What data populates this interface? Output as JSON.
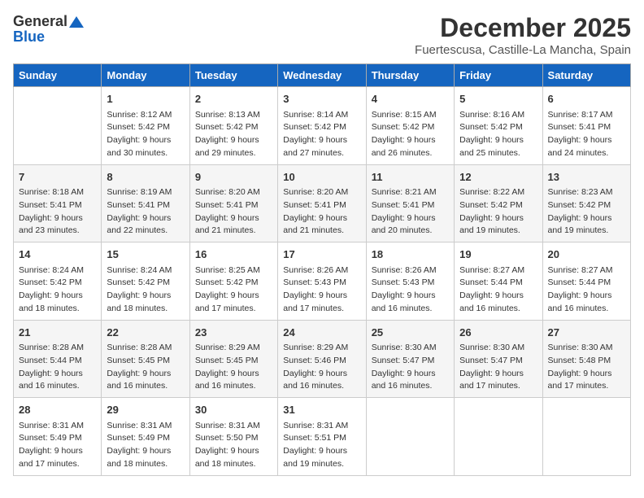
{
  "logo": {
    "general": "General",
    "blue": "Blue"
  },
  "title": "December 2025",
  "subtitle": "Fuertescusa, Castille-La Mancha, Spain",
  "days_of_week": [
    "Sunday",
    "Monday",
    "Tuesday",
    "Wednesday",
    "Thursday",
    "Friday",
    "Saturday"
  ],
  "weeks": [
    [
      {
        "day": "",
        "info": ""
      },
      {
        "day": "1",
        "info": "Sunrise: 8:12 AM\nSunset: 5:42 PM\nDaylight: 9 hours\nand 30 minutes."
      },
      {
        "day": "2",
        "info": "Sunrise: 8:13 AM\nSunset: 5:42 PM\nDaylight: 9 hours\nand 29 minutes."
      },
      {
        "day": "3",
        "info": "Sunrise: 8:14 AM\nSunset: 5:42 PM\nDaylight: 9 hours\nand 27 minutes."
      },
      {
        "day": "4",
        "info": "Sunrise: 8:15 AM\nSunset: 5:42 PM\nDaylight: 9 hours\nand 26 minutes."
      },
      {
        "day": "5",
        "info": "Sunrise: 8:16 AM\nSunset: 5:42 PM\nDaylight: 9 hours\nand 25 minutes."
      },
      {
        "day": "6",
        "info": "Sunrise: 8:17 AM\nSunset: 5:41 PM\nDaylight: 9 hours\nand 24 minutes."
      }
    ],
    [
      {
        "day": "7",
        "info": "Sunrise: 8:18 AM\nSunset: 5:41 PM\nDaylight: 9 hours\nand 23 minutes."
      },
      {
        "day": "8",
        "info": "Sunrise: 8:19 AM\nSunset: 5:41 PM\nDaylight: 9 hours\nand 22 minutes."
      },
      {
        "day": "9",
        "info": "Sunrise: 8:20 AM\nSunset: 5:41 PM\nDaylight: 9 hours\nand 21 minutes."
      },
      {
        "day": "10",
        "info": "Sunrise: 8:20 AM\nSunset: 5:41 PM\nDaylight: 9 hours\nand 21 minutes."
      },
      {
        "day": "11",
        "info": "Sunrise: 8:21 AM\nSunset: 5:41 PM\nDaylight: 9 hours\nand 20 minutes."
      },
      {
        "day": "12",
        "info": "Sunrise: 8:22 AM\nSunset: 5:42 PM\nDaylight: 9 hours\nand 19 minutes."
      },
      {
        "day": "13",
        "info": "Sunrise: 8:23 AM\nSunset: 5:42 PM\nDaylight: 9 hours\nand 19 minutes."
      }
    ],
    [
      {
        "day": "14",
        "info": "Sunrise: 8:24 AM\nSunset: 5:42 PM\nDaylight: 9 hours\nand 18 minutes."
      },
      {
        "day": "15",
        "info": "Sunrise: 8:24 AM\nSunset: 5:42 PM\nDaylight: 9 hours\nand 18 minutes."
      },
      {
        "day": "16",
        "info": "Sunrise: 8:25 AM\nSunset: 5:42 PM\nDaylight: 9 hours\nand 17 minutes."
      },
      {
        "day": "17",
        "info": "Sunrise: 8:26 AM\nSunset: 5:43 PM\nDaylight: 9 hours\nand 17 minutes."
      },
      {
        "day": "18",
        "info": "Sunrise: 8:26 AM\nSunset: 5:43 PM\nDaylight: 9 hours\nand 16 minutes."
      },
      {
        "day": "19",
        "info": "Sunrise: 8:27 AM\nSunset: 5:44 PM\nDaylight: 9 hours\nand 16 minutes."
      },
      {
        "day": "20",
        "info": "Sunrise: 8:27 AM\nSunset: 5:44 PM\nDaylight: 9 hours\nand 16 minutes."
      }
    ],
    [
      {
        "day": "21",
        "info": "Sunrise: 8:28 AM\nSunset: 5:44 PM\nDaylight: 9 hours\nand 16 minutes."
      },
      {
        "day": "22",
        "info": "Sunrise: 8:28 AM\nSunset: 5:45 PM\nDaylight: 9 hours\nand 16 minutes."
      },
      {
        "day": "23",
        "info": "Sunrise: 8:29 AM\nSunset: 5:45 PM\nDaylight: 9 hours\nand 16 minutes."
      },
      {
        "day": "24",
        "info": "Sunrise: 8:29 AM\nSunset: 5:46 PM\nDaylight: 9 hours\nand 16 minutes."
      },
      {
        "day": "25",
        "info": "Sunrise: 8:30 AM\nSunset: 5:47 PM\nDaylight: 9 hours\nand 16 minutes."
      },
      {
        "day": "26",
        "info": "Sunrise: 8:30 AM\nSunset: 5:47 PM\nDaylight: 9 hours\nand 17 minutes."
      },
      {
        "day": "27",
        "info": "Sunrise: 8:30 AM\nSunset: 5:48 PM\nDaylight: 9 hours\nand 17 minutes."
      }
    ],
    [
      {
        "day": "28",
        "info": "Sunrise: 8:31 AM\nSunset: 5:49 PM\nDaylight: 9 hours\nand 17 minutes."
      },
      {
        "day": "29",
        "info": "Sunrise: 8:31 AM\nSunset: 5:49 PM\nDaylight: 9 hours\nand 18 minutes."
      },
      {
        "day": "30",
        "info": "Sunrise: 8:31 AM\nSunset: 5:50 PM\nDaylight: 9 hours\nand 18 minutes."
      },
      {
        "day": "31",
        "info": "Sunrise: 8:31 AM\nSunset: 5:51 PM\nDaylight: 9 hours\nand 19 minutes."
      },
      {
        "day": "",
        "info": ""
      },
      {
        "day": "",
        "info": ""
      },
      {
        "day": "",
        "info": ""
      }
    ]
  ]
}
